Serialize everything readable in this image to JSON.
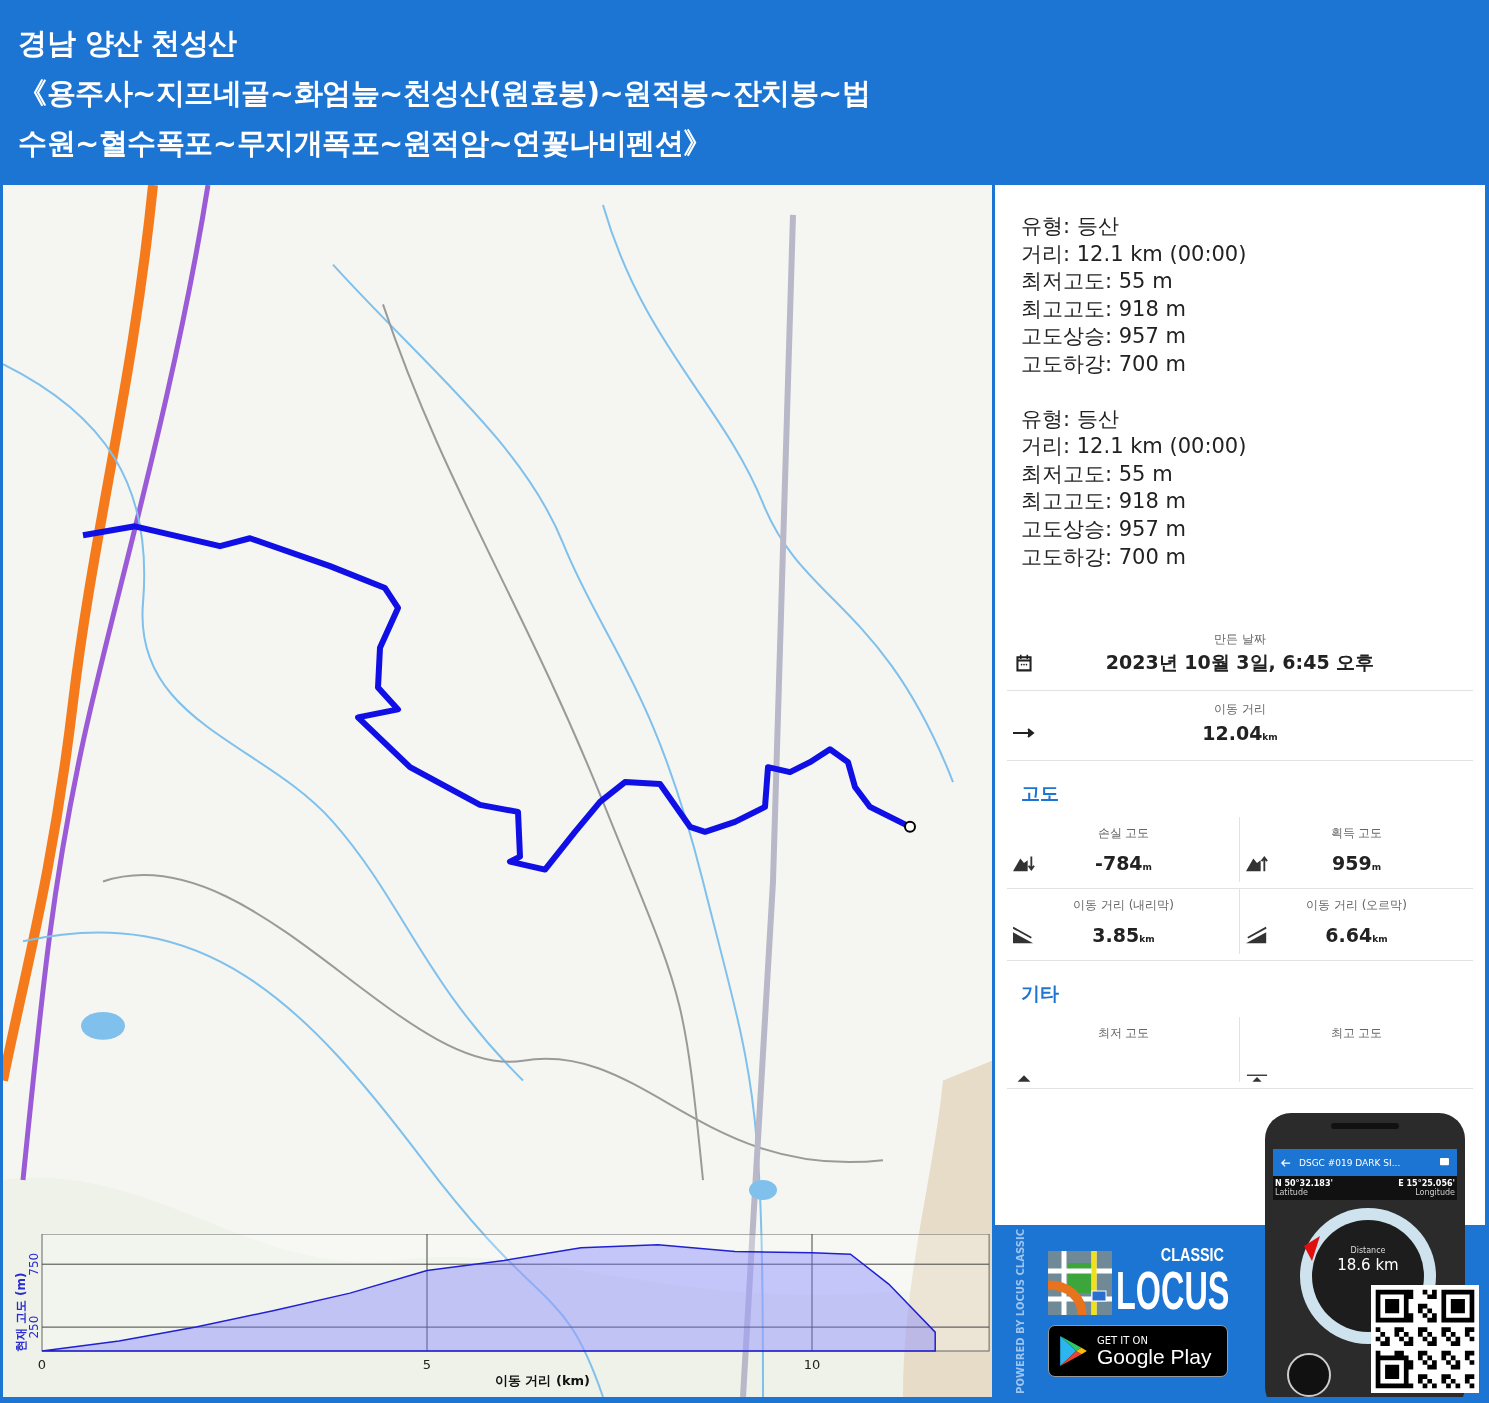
{
  "header": {
    "title_lines": [
      "경남 양산 천성산",
      "《용주사~지프네골~화엄늪~천성산(원효봉)~원적봉~잔치봉~법",
      "수원~혈수폭포~무지개폭포~원적암~연꽃나비펜션》"
    ]
  },
  "map": {
    "kind": "picture",
    "chart_data": {
      "type": "area",
      "xlabel": "이동 거리 (km)",
      "ylabel": "현재 고도 (m)",
      "x": [
        0,
        1,
        2,
        3,
        4,
        5,
        6,
        7,
        8,
        9,
        10,
        10.5,
        11,
        11.6
      ],
      "values": [
        60,
        140,
        250,
        380,
        520,
        700,
        780,
        880,
        905,
        850,
        840,
        830,
        590,
        210
      ],
      "xlim": [
        0,
        12.3
      ],
      "ylim": [
        60,
        990
      ],
      "xticks": [
        0,
        5,
        10
      ],
      "yticks": [
        250,
        750
      ],
      "grid": true
    }
  },
  "track_stats": [
    {
      "lines": [
        "유형: 등산",
        "거리: 12.1 km (00:00)",
        "최저고도: 55 m",
        "최고고도: 918 m",
        "고도상승: 957 m",
        "고도하강: 700 m"
      ]
    },
    {
      "lines": [
        "유형: 등산",
        "거리: 12.1 km (00:00)",
        "최저고도: 55 m",
        "최고고도: 918 m",
        "고도상승: 957 m",
        "고도하강: 700 m"
      ]
    }
  ],
  "details": [
    {
      "kind": "date",
      "label": "만든 날짜",
      "value": "2023년 10월 3일, 6:45 오후"
    },
    {
      "kind": "distance",
      "label": "이동 거리",
      "value": "12.04",
      "unit": "km"
    }
  ],
  "sections": [
    {
      "title": "고도",
      "stats": [
        {
          "kind": "descent",
          "label": "손실 고도",
          "value": "-784",
          "unit": "m"
        },
        {
          "kind": "ascent",
          "label": "획득 고도",
          "value": "959",
          "unit": "m"
        },
        {
          "kind": "downhill",
          "label": "이동 거리 (내리막)",
          "value": "3.85",
          "unit": "km"
        },
        {
          "kind": "uphill",
          "label": "이동 거리 (오르막)",
          "value": "6.64",
          "unit": "km"
        }
      ]
    },
    {
      "title": "기타",
      "stats": [
        {
          "kind": "min",
          "label": "최저 고도"
        },
        {
          "kind": "max",
          "label": "최고 고도"
        }
      ]
    }
  ],
  "promo": {
    "powered": "POWERED BY LOCUS CLASSIC",
    "logo_small": "CLASSIC",
    "logo_big": "LOCUS",
    "store_small": "GET IT ON",
    "store_big": "Google Play",
    "phone": {
      "title": "DSGC #019 DARK SI...",
      "lat": "N 50°32.183'",
      "lat_label": "Latitude",
      "lon": "E 15°25.056'",
      "lon_label": "Longitude",
      "distance_label": "Distance",
      "distance": "18.6 km"
    }
  }
}
